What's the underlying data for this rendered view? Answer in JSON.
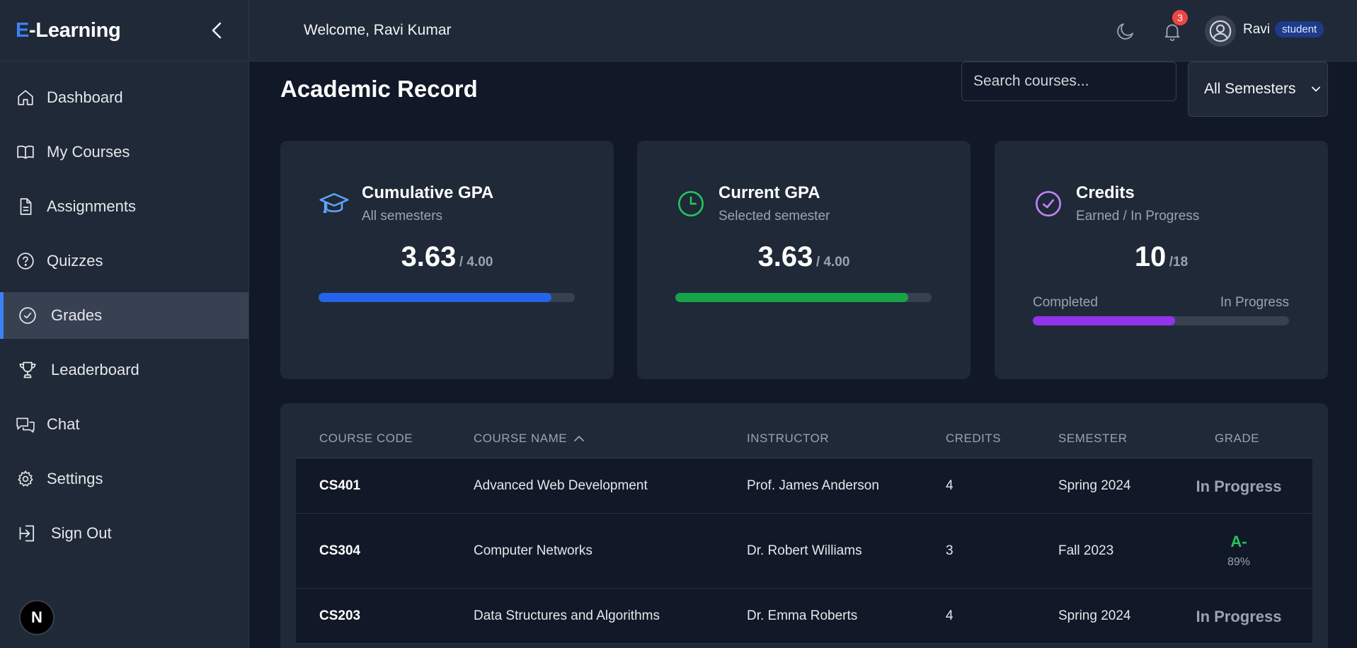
{
  "brand": {
    "prefix": "E",
    "suffix": "-Learning"
  },
  "sidebar": {
    "items": [
      {
        "label": "Dashboard",
        "icon": "home-icon"
      },
      {
        "label": "My Courses",
        "icon": "book-icon"
      },
      {
        "label": "Assignments",
        "icon": "document-icon"
      },
      {
        "label": "Quizzes",
        "icon": "question-circle-icon"
      },
      {
        "label": "Grades",
        "icon": "check-circle-icon",
        "active": true
      },
      {
        "label": "Leaderboard",
        "icon": "trophy-icon"
      },
      {
        "label": "Chat",
        "icon": "chat-bubbles-icon"
      },
      {
        "label": "Settings",
        "icon": "gear-icon"
      },
      {
        "label": "Sign Out",
        "icon": "sign-out-icon"
      }
    ],
    "footer_badge": "N"
  },
  "header": {
    "welcome": "Welcome, Ravi Kumar",
    "notification_count": "3",
    "user_name": "Ravi",
    "role": "student"
  },
  "main": {
    "title": "Academic Record",
    "search_placeholder": "Search courses...",
    "semester_filter": "All Semesters"
  },
  "cards": {
    "cumulative": {
      "title": "Cumulative GPA",
      "subtitle": "All semesters",
      "value": "3.63",
      "max": "/ 4.00",
      "progress": 0.9075,
      "color": "#2563eb"
    },
    "current": {
      "title": "Current GPA",
      "subtitle": "Selected semester",
      "value": "3.63",
      "max": "/ 4.00",
      "progress": 0.9075,
      "color": "#16a34a"
    },
    "credits": {
      "title": "Credits",
      "subtitle": "Earned / In Progress",
      "value": "10",
      "max": "/18",
      "legend_left": "Completed",
      "legend_right": "In Progress",
      "progress": 0.5556,
      "color": "#9333ea"
    }
  },
  "table": {
    "headers": {
      "code": "COURSE CODE",
      "name": "COURSE NAME",
      "instructor": "INSTRUCTOR",
      "credits": "CREDITS",
      "semester": "SEMESTER",
      "grade": "GRADE"
    },
    "rows": [
      {
        "code": "CS401",
        "name": "Advanced Web Development",
        "instructor": "Prof. James Anderson",
        "credits": "4",
        "semester": "Spring 2024",
        "grade": "In Progress",
        "percent": ""
      },
      {
        "code": "CS304",
        "name": "Computer Networks",
        "instructor": "Dr. Robert Williams",
        "credits": "3",
        "semester": "Fall 2023",
        "grade": "A-",
        "percent": "89%"
      },
      {
        "code": "CS203",
        "name": "Data Structures and Algorithms",
        "instructor": "Dr. Emma Roberts",
        "credits": "4",
        "semester": "Spring 2024",
        "grade": "In Progress",
        "percent": ""
      }
    ]
  },
  "colors": {
    "accent": "#3b82f6",
    "grade_good": "#22c55e",
    "notification": "#ef4444"
  }
}
